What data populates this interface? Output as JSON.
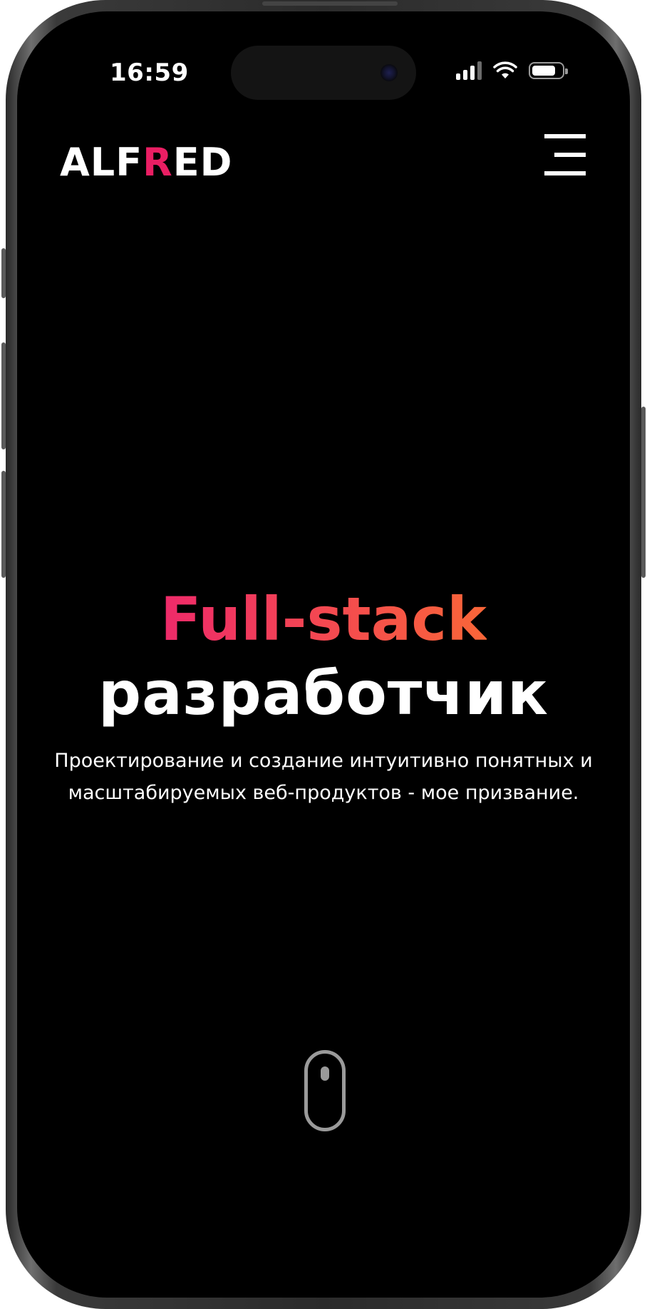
{
  "status_bar": {
    "time": "16:59",
    "signal_icon": "cellular-signal-icon",
    "wifi_icon": "wifi-icon",
    "battery_icon": "battery-icon",
    "battery_level": 0.8
  },
  "header": {
    "logo_prefix": "ALF",
    "logo_accent": "R",
    "logo_suffix": "ED",
    "logo_accent_color": "#ea1e63",
    "menu_icon": "hamburger-menu-icon"
  },
  "hero": {
    "title_line1": "Full-stack",
    "title_line2": "разработчик",
    "title_gradient": [
      "#ee2a6a",
      "#f96638"
    ],
    "description": "Проектирование и создание интуитивно понятных и масштабируемых веб-продуктов - мое призвание."
  },
  "scroll_indicator": {
    "icon": "mouse-scroll-icon"
  }
}
